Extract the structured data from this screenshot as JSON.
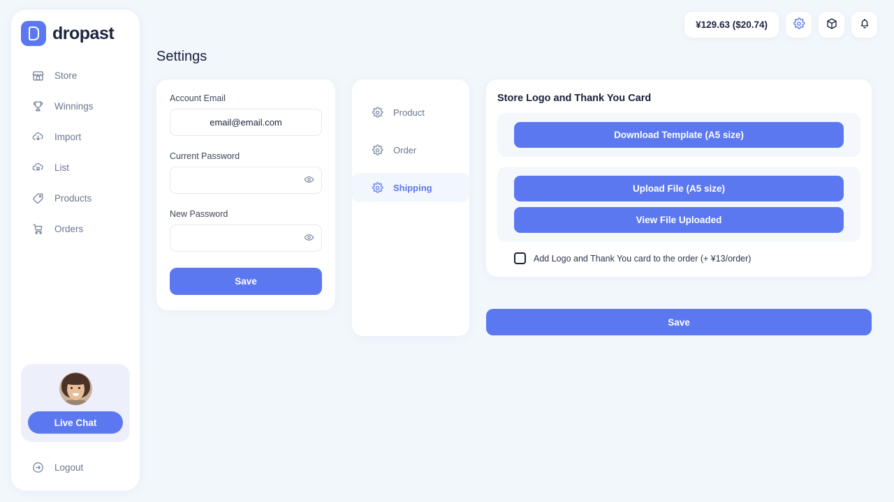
{
  "brand": {
    "name": "dropast",
    "logo_icon": "dropast-d-logo",
    "accent": "#5b78f0"
  },
  "sidebar": {
    "items": [
      {
        "label": "Store",
        "icon": "store-icon"
      },
      {
        "label": "Winnings",
        "icon": "trophy-icon"
      },
      {
        "label": "Import",
        "icon": "cloud-download-icon"
      },
      {
        "label": "List",
        "icon": "cloud-list-icon"
      },
      {
        "label": "Products",
        "icon": "tag-icon"
      },
      {
        "label": "Orders",
        "icon": "shopping-cart-icon"
      }
    ],
    "chat": {
      "button_label": "Live Chat",
      "avatar_icon": "support-agent-avatar"
    },
    "logout": {
      "label": "Logout",
      "icon": "logout-icon"
    }
  },
  "header": {
    "balance": "¥129.63 ($20.74)",
    "icons": [
      {
        "name": "gear-icon",
        "active": true
      },
      {
        "name": "package-icon",
        "active": false
      },
      {
        "name": "bell-icon",
        "active": false
      }
    ]
  },
  "page": {
    "title": "Settings"
  },
  "account": {
    "email_label": "Account Email",
    "email_value": "email@email.com",
    "email_placeholder": "email@email.com",
    "current_password_label": "Current Password",
    "current_password_value": "",
    "current_password_placeholder": "",
    "new_password_label": "New Password",
    "new_password_value": "",
    "new_password_placeholder": "",
    "save_label": "Save",
    "toggle_icon": "eye-icon"
  },
  "settings_nav": {
    "items": [
      {
        "label": "Product",
        "icon": "gear-icon",
        "active": false
      },
      {
        "label": "Order",
        "icon": "gear-icon",
        "active": false
      },
      {
        "label": "Shipping",
        "icon": "gear-icon",
        "active": true
      }
    ]
  },
  "logo_panel": {
    "title": "Store Logo and Thank You Card",
    "download_label": "Download Template (A5 size)",
    "upload_label": "Upload File (A5 size)",
    "view_label": "View File Uploaded",
    "checkbox_label": "Add Logo and Thank You card to the order (+ ¥13/order)",
    "checkbox_checked": false,
    "save_label": "Save"
  }
}
